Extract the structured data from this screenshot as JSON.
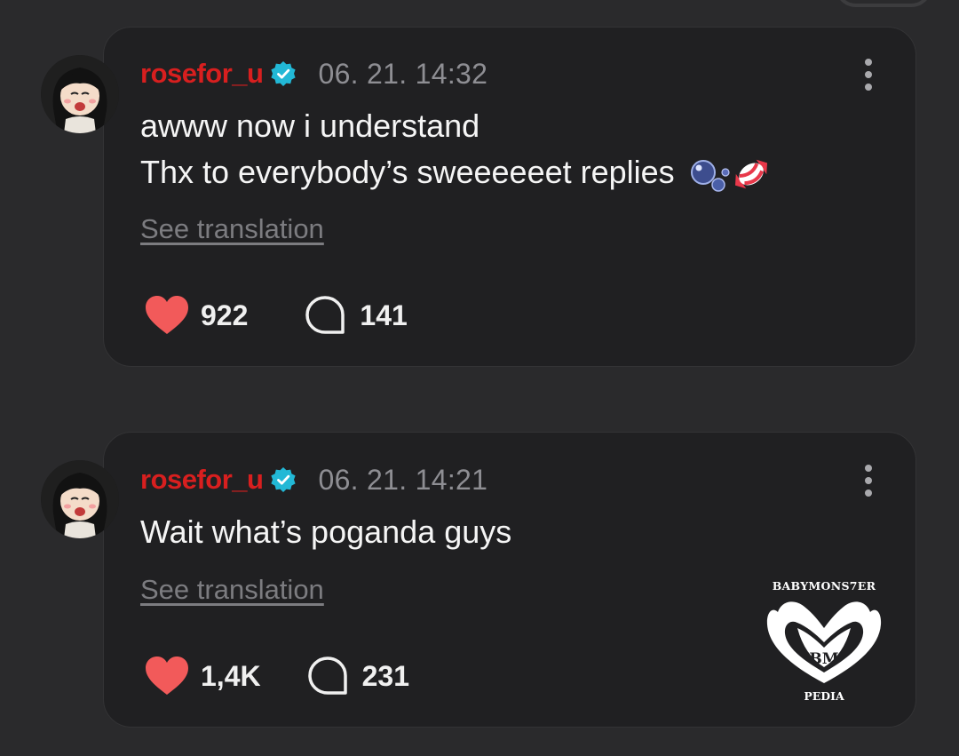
{
  "posts": [
    {
      "username": "rosefor_u",
      "timestamp": "06. 21. 14:32",
      "text_lines": [
        "awww now i understand",
        "Thx to everybody’s sweeeeeet replies"
      ],
      "see_translation": "See translation",
      "likes": "922",
      "comments": "141"
    },
    {
      "username": "rosefor_u",
      "timestamp": "06. 21. 14:21",
      "text_lines": [
        "Wait what’s poganda guys"
      ],
      "see_translation": "See translation",
      "likes": "1,4K",
      "comments": "231"
    }
  ],
  "watermark": {
    "top": "BABYMONS7ER",
    "bottom": "PEDIA"
  },
  "icons": {
    "verified": "verified-badge-icon",
    "more": "more-vertical-icon",
    "like": "heart-icon",
    "comment": "comment-bubble-icon",
    "emoji": [
      "bubbles-emoji",
      "candy-emoji"
    ]
  },
  "colors": {
    "background": "#2a2a2c",
    "card": "#202022",
    "username": "#d81f1f",
    "verified": "#22b8d6",
    "heart": "#f25a5a",
    "muted": "#8e8e93"
  }
}
